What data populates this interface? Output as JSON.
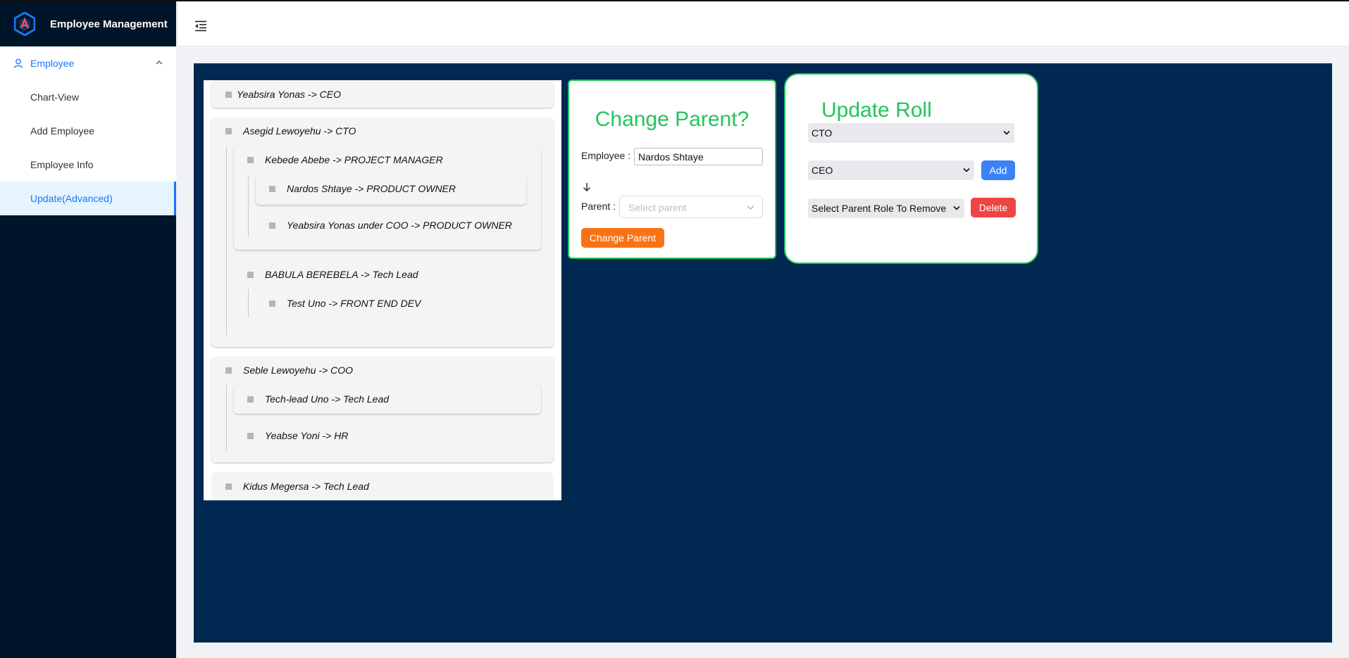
{
  "app": {
    "title": "Employee Management"
  },
  "sidebar": {
    "group_label": "Employee",
    "items": [
      {
        "label": "Chart-View",
        "active": false
      },
      {
        "label": "Add Employee",
        "active": false
      },
      {
        "label": "Employee Info",
        "active": false
      },
      {
        "label": "Update(Advanced)",
        "active": true
      }
    ]
  },
  "tree": {
    "nodes": [
      "Yeabsira Yonas -> CEO",
      "Asegid Lewoyehu -> CTO",
      "Kebede Abebe -> PROJECT MANAGER",
      "Nardos Shtaye -> PRODUCT OWNER",
      "Yeabsira Yonas under COO -> PRODUCT OWNER",
      "BABULA BEREBELA -> Tech Lead",
      "Test Uno -> FRONT END DEV",
      "Seble Lewoyehu -> COO",
      "Tech-lead Uno -> Tech Lead",
      "Yeabse Yoni -> HR",
      "Kidus Megersa -> Tech Lead"
    ]
  },
  "change_parent": {
    "title": "Change Parent?",
    "employee_label": "Employee",
    "employee_value": "Nardos Shtaye",
    "parent_label": "Parent",
    "parent_placeholder": "Select parent",
    "button": "Change Parent"
  },
  "update_roll": {
    "title": "Update Roll",
    "role_select": "CTO",
    "parent_select": "CEO",
    "add_button": "Add",
    "remove_select": "Select Parent Role To Remove",
    "delete_button": "Delete"
  },
  "colors": {
    "sidebar_bg": "#001529",
    "content_bg": "#002850",
    "accent": "#1677ff",
    "green": "#22c55e",
    "orange": "#f97316",
    "blue": "#3b82f6",
    "red": "#ef4444"
  }
}
